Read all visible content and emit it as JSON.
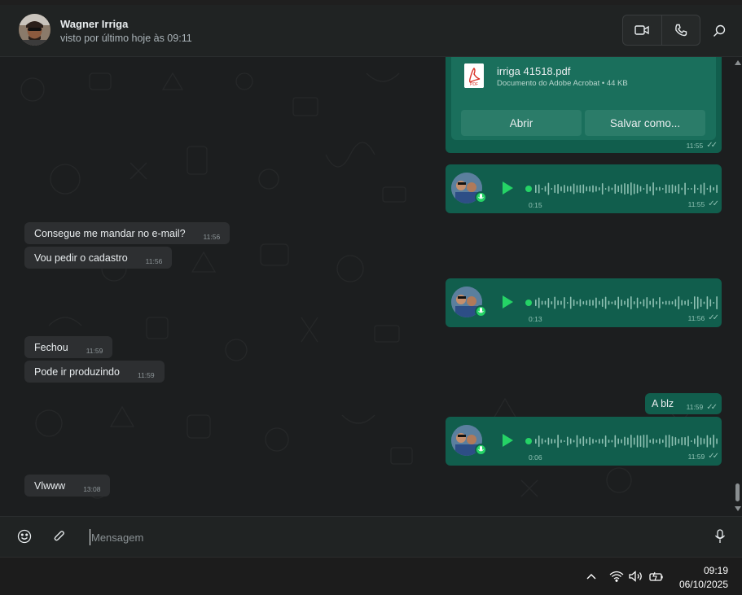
{
  "header": {
    "contact_name": "Wagner Irriga",
    "status": "visto por último hoje às 09:11",
    "icons": {
      "video": "video-camera-icon",
      "call": "phone-icon",
      "search": "search-icon"
    }
  },
  "document_message": {
    "file_name": "irriga 41518.pdf",
    "file_meta": "Documento do Adobe Acrobat • 44 KB",
    "open_label": "Abrir",
    "save_label": "Salvar como...",
    "time": "11:55",
    "icon": "pdf-icon",
    "pdf_label": "PDF"
  },
  "messages": [
    {
      "type": "voice",
      "direction": "out",
      "duration": "0:15",
      "time": "11:55",
      "progress": 0
    },
    {
      "type": "text",
      "direction": "in",
      "text": "Consegue me mandar no e-mail?",
      "time": "11:56"
    },
    {
      "type": "text",
      "direction": "in",
      "text": "Vou pedir o cadastro",
      "time": "11:56"
    },
    {
      "type": "voice",
      "direction": "out",
      "duration": "0:13",
      "time": "11:56",
      "progress": 0
    },
    {
      "type": "text",
      "direction": "in",
      "text": "Fechou",
      "time": "11:59"
    },
    {
      "type": "text",
      "direction": "in",
      "text": "Pode ir produzindo",
      "time": "11:59"
    },
    {
      "type": "text",
      "direction": "out",
      "text": "A blz",
      "time": "11:59"
    },
    {
      "type": "voice",
      "direction": "out",
      "duration": "0:06",
      "time": "11:59",
      "progress": 0
    },
    {
      "type": "text",
      "direction": "in",
      "text": "Vlwww",
      "time": "13:08"
    }
  ],
  "ticks_symbol": "✓✓",
  "composer": {
    "placeholder": "Mensagem",
    "icons": {
      "emoji": "emoji-icon",
      "attach": "paperclip-icon",
      "mic": "microphone-icon"
    }
  },
  "taskbar": {
    "time": "09:19",
    "date": "06/10/2025",
    "icons": [
      "chevron-up-icon",
      "wifi-icon",
      "volume-icon",
      "battery-icon"
    ]
  },
  "colors": {
    "outgoing_bubble": "#115e4d",
    "incoming_bubble": "#2d2f31",
    "accent": "#25d366",
    "background": "#1c1e1f"
  }
}
